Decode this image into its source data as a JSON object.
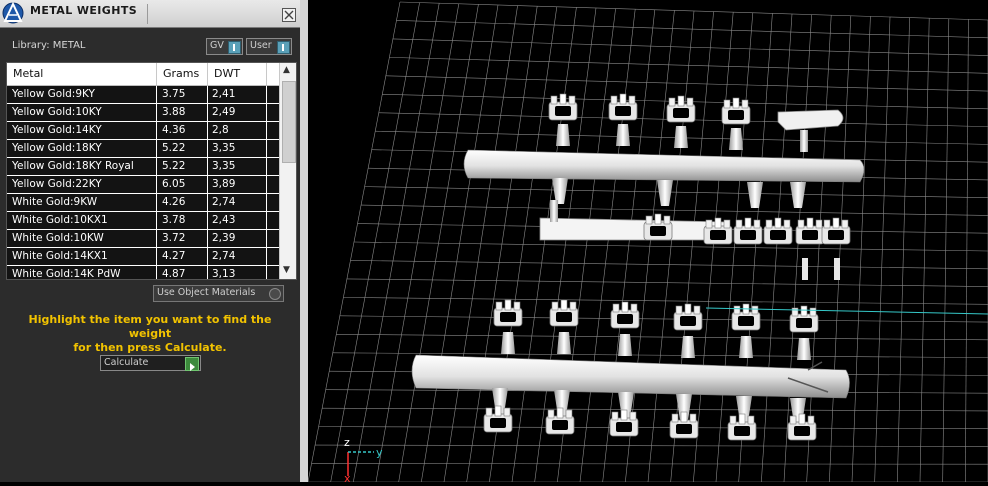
{
  "panel": {
    "title": "METAL WEIGHTS",
    "library_text": "Library: METAL",
    "toggles": [
      {
        "label": "GV"
      },
      {
        "label": "User"
      }
    ],
    "table": {
      "columns": [
        "Metal",
        "Grams",
        "DWT"
      ],
      "rows": [
        [
          "Yellow Gold:9KY",
          "3.75",
          "2,41"
        ],
        [
          "Yellow Gold:10KY",
          "3.88",
          "2,49"
        ],
        [
          "Yellow Gold:14KY",
          "4.36",
          "2,8"
        ],
        [
          "Yellow Gold:18KY",
          "5.22",
          "3,35"
        ],
        [
          "Yellow Gold:18KY Royal",
          "5.22",
          "3,35"
        ],
        [
          "Yellow Gold:22KY",
          "6.05",
          "3,89"
        ],
        [
          "White Gold:9KW",
          "4.26",
          "2,74"
        ],
        [
          "White Gold:10KX1",
          "3.78",
          "2,43"
        ],
        [
          "White Gold:10KW",
          "3.72",
          "2,39"
        ],
        [
          "White Gold:14KX1",
          "4.27",
          "2,74"
        ],
        [
          "White Gold:14K PdW",
          "4.87",
          "3,13"
        ]
      ]
    },
    "use_object_materials_label": "Use Object Materials",
    "info_text_line1": "Highlight the item you want to find the weight",
    "info_text_line2": "for then press Calculate.",
    "calculate_label": "Calculate"
  },
  "viewport": {
    "axis_z": "z",
    "axis_y": "y",
    "axis_x": "x"
  },
  "colors": {
    "accent_yellow": "#f2c300",
    "grid_line": "#9a9a9a",
    "axis_z": "#ff3030",
    "axis_y": "#35c8c8",
    "axis_x": "#ff3030"
  }
}
